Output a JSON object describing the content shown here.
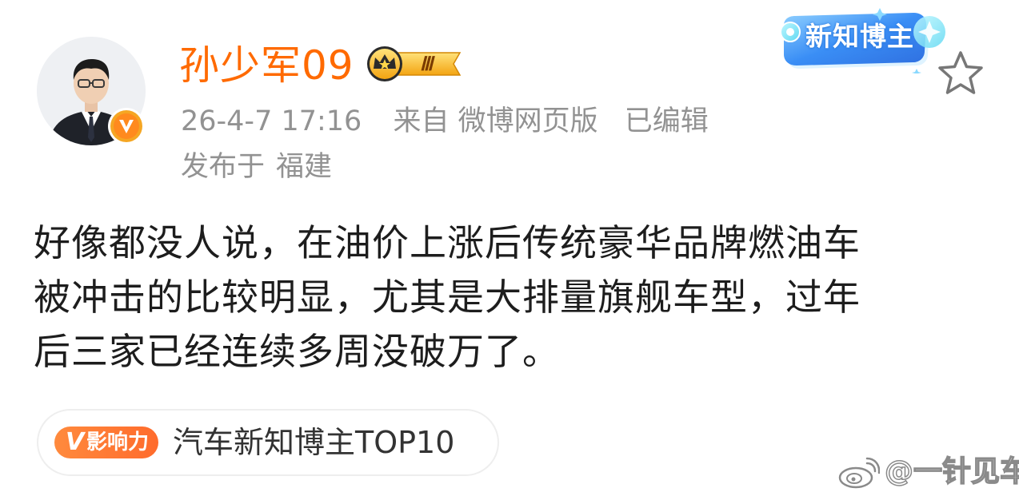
{
  "post": {
    "author": {
      "name": "孙少军09",
      "level_badge": "Ⅲ",
      "avatar_icon": "person-avatar"
    },
    "meta": {
      "time": "26-4-7 17:16",
      "source": "来自 微博网页版",
      "edited": "已编辑",
      "location_prefix": "发布于",
      "location": "福建"
    },
    "body": "好像都没人说，在油价上涨后传统豪华品牌燃油车\n被冲击的比较明显，尤其是大排量旗舰车型，过年\n后三家已经连续多周没破万了。",
    "influence": {
      "badge_v": "V",
      "badge_label": "影响力",
      "title": "汽车新知博主TOP10"
    }
  },
  "header": {
    "new_blogger_label": "新知博主"
  },
  "watermark": {
    "text": "@一针见车"
  },
  "colors": {
    "name": "#ff6a00",
    "meta": "#929292",
    "body": "#1d1d1d",
    "influence_badge": "#ff7a35",
    "badge_blue": "#3a8ef5"
  }
}
